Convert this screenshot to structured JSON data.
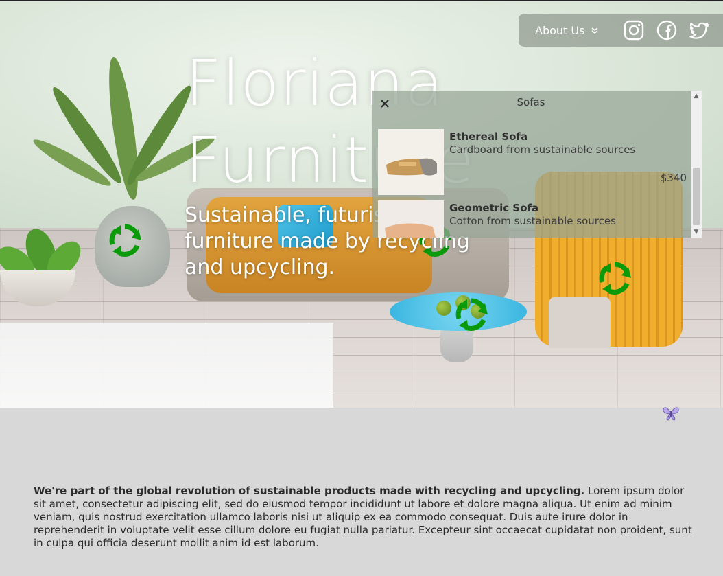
{
  "hero": {
    "title_line1": "Floriana",
    "title_line2": "Furniture",
    "subtitle": "Sustainable, futuristic furniture made by recycling and upcycling."
  },
  "nav": {
    "about_label": "About Us",
    "icons": [
      "instagram-icon",
      "facebook-icon",
      "twitter-icon"
    ]
  },
  "panel": {
    "title": "Sofas",
    "items": [
      {
        "name": "Ethereal Sofa",
        "description": "Cardboard from sustainable sources",
        "price": "$340"
      },
      {
        "name": "Geometric Sofa",
        "description": "Cotton from sustainable sources",
        "price": ""
      }
    ]
  },
  "about": {
    "lead": "We're part of the global revolution of sustainable products made with recycling and upcycling.",
    "body": " Lorem ipsum dolor sit amet, consectetur adipiscing elit, sed do eiusmod tempor incididunt ut labore et dolore magna aliqua. Ut enim ad minim veniam, quis nostrud exercitation ullamco laboris nisi ut aliquip ex ea commodo consequat. Duis aute irure dolor in reprehenderit in voluptate velit esse cillum dolore eu fugiat nulla pariatur. Excepteur sint occaecat cupidatat non proident, sunt in culpa qui officia deserunt mollit anim id est laborum."
  },
  "colors": {
    "recycle_green": "#0a9a0a",
    "hero_text": "#ffffff",
    "section_bg": "#d8d8d8"
  }
}
